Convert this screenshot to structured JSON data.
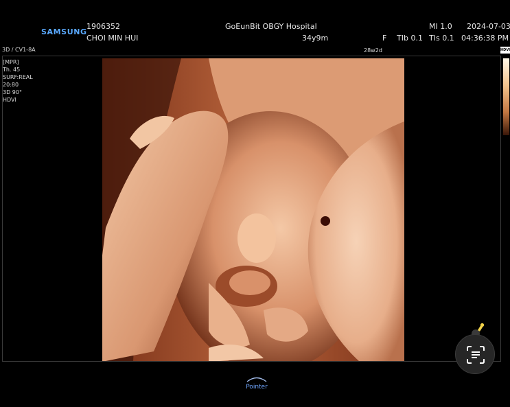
{
  "header": {
    "brand": "SAMSUNG",
    "patient_id": "1906352",
    "patient_name": "CHOI MIN HUI",
    "hospital": "GoEunBit OBGY Hospital",
    "age": "34y9m",
    "sex": "F",
    "tib": "TIb 0.1",
    "mi": "MI 1.0",
    "tis": "TIs 0.1",
    "date": "2024-07-03",
    "time": "04:36:38 PM"
  },
  "probe": "3D / CV1-8A",
  "gestational_age": "28w2d",
  "image_info": [
    "[MPR]",
    "Th. 45",
    "SURF:REAL",
    "20:80",
    "3D 90°",
    "HDVI"
  ],
  "colorbar_tag": "HDVI",
  "footer": {
    "pointer_label": "Pointer"
  },
  "icons": {
    "lens": "screen-text-scan-icon",
    "pin": "pushpin-icon",
    "pointer_arc": "pointer-arc-icon"
  },
  "colors": {
    "brand": "#5aa9ff",
    "pointer": "#6fa6ff",
    "skin_light": "#f3c6a4",
    "skin_mid": "#d8926b",
    "skin_dark": "#5a2512"
  }
}
